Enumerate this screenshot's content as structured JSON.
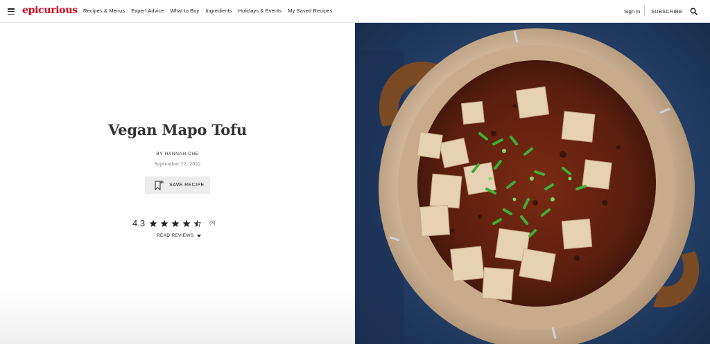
{
  "header": {
    "logo": "epicurious",
    "nav": [
      "Recipes & Menus",
      "Expert Advice",
      "What to Buy",
      "Ingredients",
      "Holidays & Events",
      "My Saved Recipes"
    ],
    "signin": "Sign In",
    "subscribe": "SUBSCRIBE",
    "icons": [
      "hamburger-icon",
      "search-icon"
    ]
  },
  "recipe": {
    "title": "Vegan Mapo Tofu",
    "byline": "BY HANNAH CHE",
    "date": "September 12, 2022",
    "save_label": "SAVE RECIPE",
    "rating": "4.3",
    "rating_value": 4.3,
    "rating_max": 5,
    "review_count": "(3)",
    "read_reviews": "READ REVIEWS"
  },
  "colors": {
    "brand": "#d0021b",
    "button_bg": "#ececec"
  }
}
